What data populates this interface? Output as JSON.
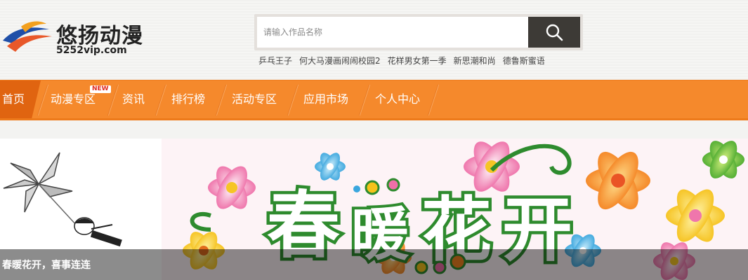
{
  "logo": {
    "title": "悠扬动漫",
    "domain": "5252vip.com"
  },
  "search": {
    "placeholder": "请输入作品名称",
    "button_icon": "search-icon"
  },
  "hot_words": [
    "乒乓王子",
    "何大马漫画闹闹校园2",
    "花样男女第一季",
    "新思潮和尚",
    "德鲁斯蜜语"
  ],
  "nav": {
    "items": [
      {
        "label": "首页",
        "active": true
      },
      {
        "label": "动漫专区",
        "badge": "NEW"
      },
      {
        "label": "资讯"
      },
      {
        "label": "排行榜"
      },
      {
        "label": "活动专区"
      },
      {
        "label": "应用市场"
      },
      {
        "label": "个人中心"
      }
    ]
  },
  "banner": {
    "artwork_text": "春暖花开",
    "caption": "春暖花开，喜事连连"
  },
  "colors": {
    "nav_orange": "#f5892c",
    "nav_active": "#e06410",
    "search_button": "#3d3a36",
    "banner_green": "#2e8b2e"
  }
}
